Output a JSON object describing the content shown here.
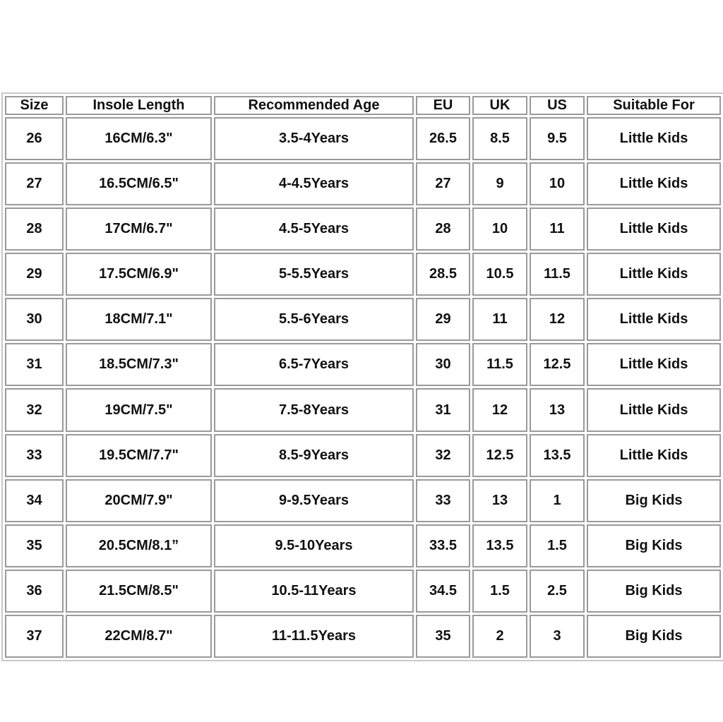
{
  "headers": [
    "Size",
    "Insole Length",
    "Recommended Age",
    "EU",
    "UK",
    "US",
    "Suitable For"
  ],
  "rows": [
    [
      "26",
      "16CM/6.3\"",
      "3.5-4Years",
      "26.5",
      "8.5",
      "9.5",
      "Little Kids"
    ],
    [
      "27",
      "16.5CM/6.5\"",
      "4-4.5Years",
      "27",
      "9",
      "10",
      "Little Kids"
    ],
    [
      "28",
      "17CM/6.7\"",
      "4.5-5Years",
      "28",
      "10",
      "11",
      "Little Kids"
    ],
    [
      "29",
      "17.5CM/6.9\"",
      "5-5.5Years",
      "28.5",
      "10.5",
      "11.5",
      "Little Kids"
    ],
    [
      "30",
      "18CM/7.1\"",
      "5.5-6Years",
      "29",
      "11",
      "12",
      "Little Kids"
    ],
    [
      "31",
      "18.5CM/7.3\"",
      "6.5-7Years",
      "30",
      "11.5",
      "12.5",
      "Little Kids"
    ],
    [
      "32",
      "19CM/7.5\"",
      "7.5-8Years",
      "31",
      "12",
      "13",
      "Little Kids"
    ],
    [
      "33",
      "19.5CM/7.7\"",
      "8.5-9Years",
      "32",
      "12.5",
      "13.5",
      "Little Kids"
    ],
    [
      "34",
      "20CM/7.9\"",
      "9-9.5Years",
      "33",
      "13",
      "1",
      "Big Kids"
    ],
    [
      "35",
      "20.5CM/8.1”",
      "9.5-10Years",
      "33.5",
      "13.5",
      "1.5",
      "Big Kids"
    ],
    [
      "36",
      "21.5CM/8.5\"",
      "10.5-11Years",
      "34.5",
      "1.5",
      "2.5",
      "Big Kids"
    ],
    [
      "37",
      "22CM/8.7\"",
      "11-11.5Years",
      "35",
      "2",
      "3",
      "Big Kids"
    ]
  ]
}
